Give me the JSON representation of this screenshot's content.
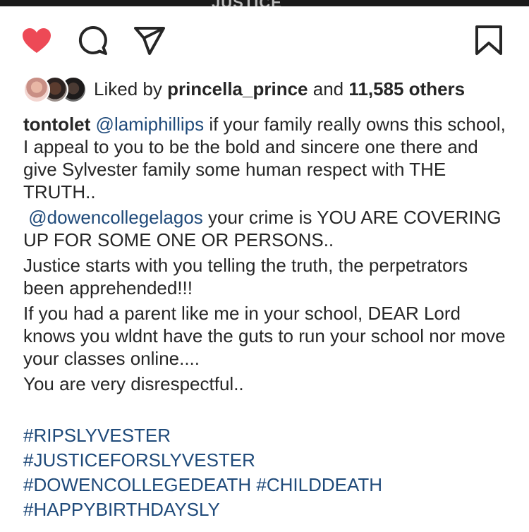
{
  "top_strip_text": "JUSTICE",
  "actions": {
    "like_icon": "heart-filled-icon",
    "comment_icon": "comment-icon",
    "share_icon": "send-icon",
    "save_icon": "bookmark-icon",
    "like_color": "#ed4956"
  },
  "likes": {
    "prefix": "Liked by",
    "user": "princella_prince",
    "connector": "and",
    "count": "11,585 others"
  },
  "caption": {
    "author": "tontolet",
    "mention1": "@lamiphillips",
    "p1_text": " if your family really owns this school, I appeal to you to be the bold and sincere one there and give Sylvester family some human respect with THE TRUTH..",
    "mention2": "@dowencollegelagos",
    "p2_text": " your crime is YOU ARE COVERING UP FOR SOME ONE OR PERSONS..",
    "p3": "Justice starts with you telling the truth, the perpetrators been apprehended!!!",
    "p4": "If you had a parent like me in your school, DEAR Lord knows you wldnt have the guts to run your school nor move your classes online....",
    "p5": "You are very disrespectful.."
  },
  "hashtags": {
    "line1": "#RIPSLYVESTER",
    "line2": "#JUSTICEFORSLYVESTER",
    "line3a": "#DOWENCOLLEGEDEATH",
    "line3b": "#CHILDDEATH",
    "line4": "#HAPPYBIRTHDAYSLY"
  }
}
